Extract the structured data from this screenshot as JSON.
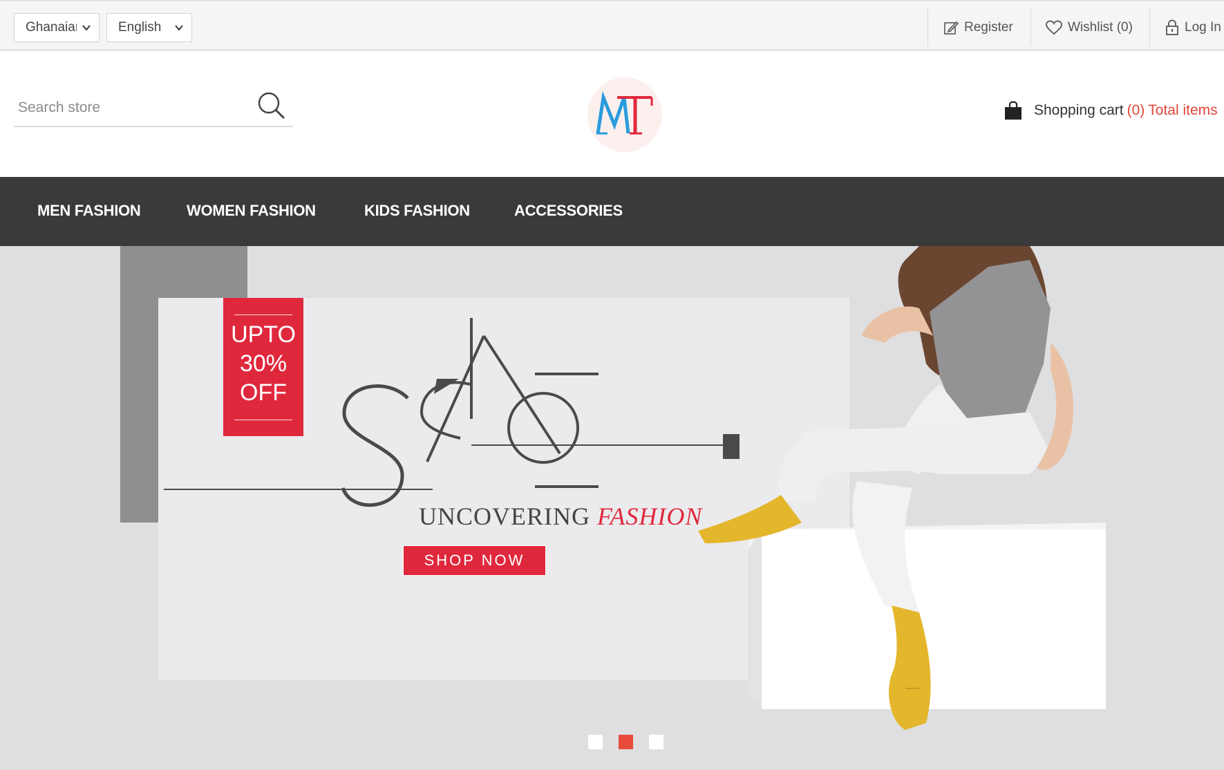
{
  "topbar": {
    "currency": "Ghanaian",
    "language": "English",
    "register": "Register",
    "wishlist": "Wishlist (0)",
    "login": "Log In"
  },
  "header": {
    "search_placeholder": "Search store",
    "logo_text": "MT",
    "cart_label": "Shopping cart",
    "cart_qty": "(0)",
    "cart_total": "Total items"
  },
  "nav": {
    "items": [
      {
        "label": "MEN FASHION"
      },
      {
        "label": "WOMEN FASHION"
      },
      {
        "label": "KIDS FASHION"
      },
      {
        "label": "ACCESSORIES"
      }
    ]
  },
  "hero": {
    "badge": [
      "UPTO",
      "30%",
      "OFF"
    ],
    "headline": "SALE",
    "tagline_main": "UNCOVERING",
    "tagline_accent": "FASHION",
    "cta": "SHOP NOW",
    "slides": 3,
    "active_slide": 2
  },
  "colors": {
    "accent": "#e0283d",
    "nav_bg": "#3a3a3b",
    "cart_highlight": "#e0463a"
  }
}
